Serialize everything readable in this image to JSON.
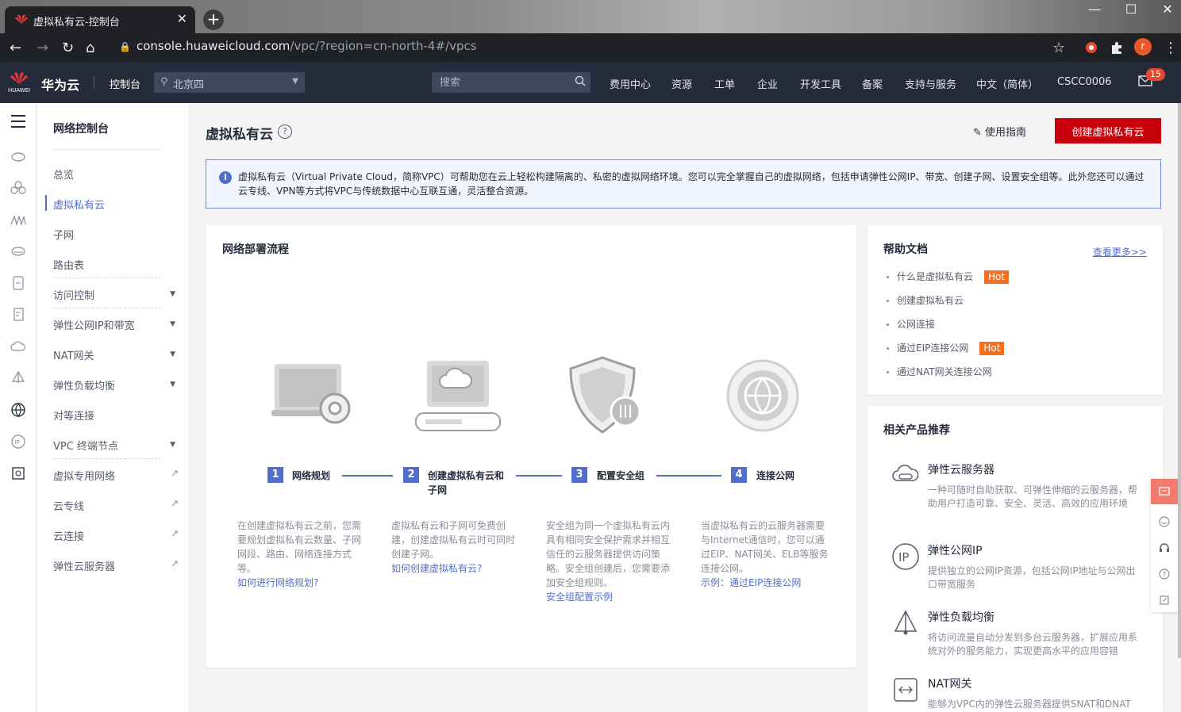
{
  "browser": {
    "tab_title": "虚拟私有云-控制台",
    "url_host": "console.huaweicloud.com",
    "url_path": "/vpc/?region=cn-north-4#/vpcs",
    "profile_initial": "r"
  },
  "header": {
    "brand": "华为云",
    "logo_text": "HUAWEI",
    "console": "控制台",
    "region": "北京四",
    "search_placeholder": "搜索",
    "nav": [
      "费用中心",
      "资源",
      "工单",
      "企业",
      "开发工具",
      "备案",
      "支持与服务",
      "中文（简体）",
      "CSCC0006"
    ],
    "notification_count": "15"
  },
  "sidebar": {
    "title": "网络控制台",
    "items": [
      {
        "label": "总览"
      },
      {
        "label": "虚拟私有云"
      },
      {
        "label": "子网"
      },
      {
        "label": "路由表"
      },
      {
        "label": "访问控制"
      },
      {
        "label": "弹性公网IP和带宽"
      },
      {
        "label": "NAT网关"
      },
      {
        "label": "弹性负载均衡"
      },
      {
        "label": "对等连接"
      },
      {
        "label": "VPC 终端节点"
      },
      {
        "label": "虚拟专用网络"
      },
      {
        "label": "云专线"
      },
      {
        "label": "云连接"
      },
      {
        "label": "弹性云服务器"
      }
    ]
  },
  "page": {
    "title": "虚拟私有云",
    "guide_label": "使用指南",
    "create_button": "创建虚拟私有云",
    "info_text": "虚拟私有云（Virtual Private Cloud，简称VPC）可帮助您在云上轻松构建隔离的、私密的虚拟网络环境。您可以完全掌握自己的虚拟网络，包括申请弹性公网IP、带宽、创建子网、设置安全组等。此外您还可以通过云专线、VPN等方式将VPC与传统数据中心互联互通，灵活整合资源。"
  },
  "flow": {
    "title": "网络部署流程",
    "steps": [
      {
        "num": "1",
        "label": "网络规划",
        "desc": "在创建虚拟私有云之前，您需要规划虚拟私有云数量、子网网段、路由、网络连接方式等。",
        "link": "如何进行网络规划?"
      },
      {
        "num": "2",
        "label": "创建虚拟私有云和子网",
        "desc": "虚拟私有云和子网可免费创建，创建虚拟私有云时可同时创建子网。",
        "link": "如何创建虚拟私有云?"
      },
      {
        "num": "3",
        "label": "配置安全组",
        "desc": "安全组为同一个虚拟私有云内具有相同安全保护需求并相互信任的云服务器提供访问策略。安全组创建后，您需要添加安全组规则。",
        "link": "安全组配置示例"
      },
      {
        "num": "4",
        "label": "连接公网",
        "desc": "当虚拟私有云的云服务器需要与Internet通信时，您可以通过EIP、NAT网关、ELB等服务连接公网。",
        "link": "示例：通过EIP连接公网"
      }
    ]
  },
  "help": {
    "title": "帮助文档",
    "more": "查看更多>>",
    "hot_label": "Hot",
    "items": [
      {
        "label": "什么是虚拟私有云",
        "hot": true
      },
      {
        "label": "创建虚拟私有云",
        "hot": false
      },
      {
        "label": "公网连接",
        "hot": false
      },
      {
        "label": "通过EIP连接公网",
        "hot": true
      },
      {
        "label": "通过NAT网关连接公网",
        "hot": false
      }
    ]
  },
  "related": {
    "title": "相关产品推荐",
    "products": [
      {
        "name": "弹性云服务器",
        "desc": "一种可随时自助获取、可弹性伸缩的云服务器，帮助用户打造可靠、安全、灵活、高效的应用环境"
      },
      {
        "name": "弹性公网IP",
        "icon_text": "IP",
        "desc": "提供独立的公网IP资源，包括公网IP地址与公网出口带宽服务"
      },
      {
        "name": "弹性负载均衡",
        "desc": "将访问流量自动分发到多台云服务器，扩展应用系统对外的服务能力，实现更高水平的应用容错"
      },
      {
        "name": "NAT网关",
        "desc": "能够为VPC内的弹性云服务器提供SNAT和DNAT"
      }
    ]
  },
  "colors": {
    "brand_red": "#c7000b",
    "accent_blue": "#526ecc",
    "header_bg": "#252b3a",
    "hot": "#f66f1e"
  }
}
